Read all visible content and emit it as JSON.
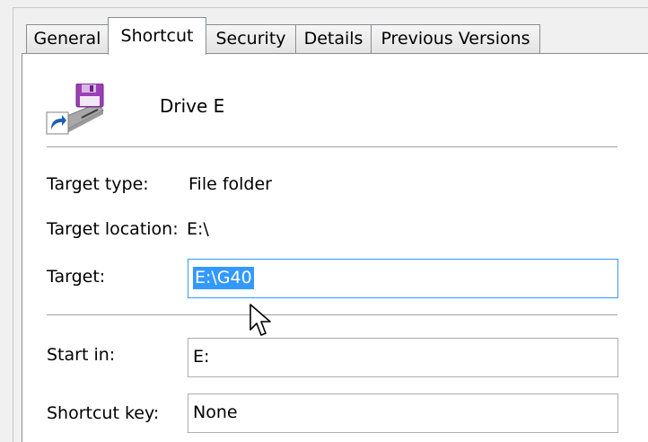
{
  "tabs": [
    "General",
    "Shortcut",
    "Security",
    "Details",
    "Previous Versions"
  ],
  "active_tab": "Shortcut",
  "shortcut_name": "Drive E",
  "fields": {
    "target_type_label": "Target type:",
    "target_type_value": "File folder",
    "target_location_label": "Target location:",
    "target_location_value": "E:\\",
    "target_label": "Target:",
    "target_value": "E:\\G40",
    "start_in_label": "Start in:",
    "start_in_value": "E:",
    "shortcut_key_label": "Shortcut key:",
    "shortcut_key_value": "None"
  },
  "icons": {
    "shortcut": "floppy-drive-shortcut-icon",
    "cursor": "mouse-pointer-icon"
  },
  "colors": {
    "selection": "#3399ff",
    "focus_border": "#3399ff",
    "tab_border": "#898c95"
  }
}
